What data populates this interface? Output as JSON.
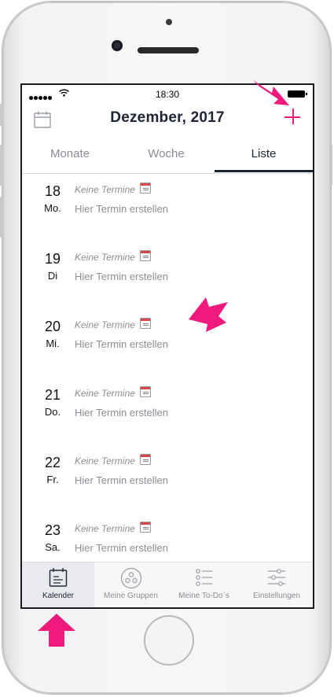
{
  "status_bar": {
    "time": "18:30"
  },
  "header": {
    "title": "Dezember, 2017"
  },
  "tabs": [
    {
      "label": "Monate"
    },
    {
      "label": "Woche"
    },
    {
      "label": "Liste"
    }
  ],
  "days": [
    {
      "number": "18",
      "name": "Mo.",
      "empty": "Keine Termine",
      "create": "Hier Termin erstellen"
    },
    {
      "number": "19",
      "name": "Di",
      "empty": "Keine Termine",
      "create": "Hier Termin erstellen"
    },
    {
      "number": "20",
      "name": "Mi.",
      "empty": "Keine Termine",
      "create": "Hier Termin erstellen"
    },
    {
      "number": "21",
      "name": "Do.",
      "empty": "Keine Termine",
      "create": "Hier Termin erstellen"
    },
    {
      "number": "22",
      "name": "Fr.",
      "empty": "Keine Termine",
      "create": "Hier Termin erstellen"
    },
    {
      "number": "23",
      "name": "Sa.",
      "empty": "Keine Termine",
      "create": "Hier Termin erstellen"
    }
  ],
  "tabbar": [
    {
      "label": "Kalender",
      "icon": "calendar-icon"
    },
    {
      "label": "Meine Gruppen",
      "icon": "groups-icon"
    },
    {
      "label": "Meine To-Do`s",
      "icon": "todo-list-icon"
    },
    {
      "label": "Einstellungen",
      "icon": "settings-sliders-icon"
    }
  ],
  "colors": {
    "accent": "#f0197c",
    "text_dark": "#1d2535",
    "text_muted": "#8a8d93"
  }
}
